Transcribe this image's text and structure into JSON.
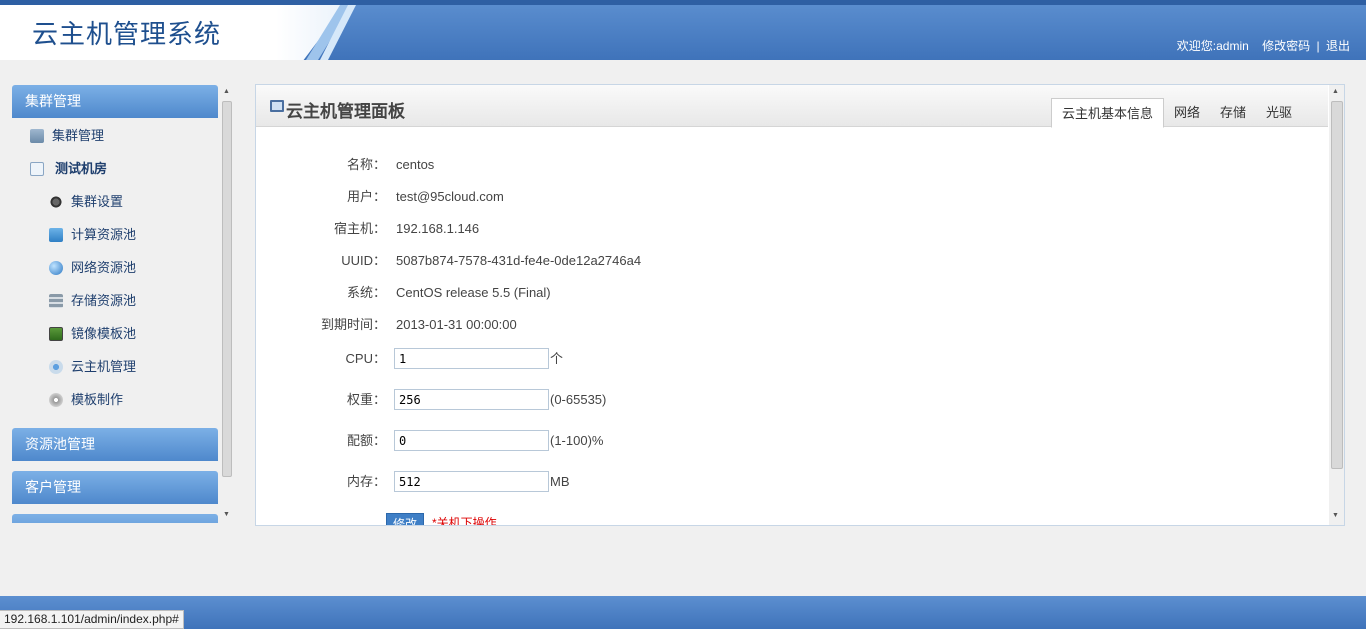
{
  "header": {
    "app_title": "云主机管理系统",
    "welcome": "欢迎您:admin",
    "change_password": "修改密码",
    "separator": "|",
    "logout": "退出"
  },
  "sidebar": {
    "group_cluster": "集群管理",
    "items": [
      {
        "label": "集群管理",
        "icon": "cluster-icon"
      },
      {
        "label": "测试机房",
        "icon": "expand-icon"
      }
    ],
    "sub_items": [
      {
        "label": "集群设置",
        "icon": "gears-icon"
      },
      {
        "label": "计算资源池",
        "icon": "folder-icon"
      },
      {
        "label": "网络资源池",
        "icon": "globe-icon"
      },
      {
        "label": "存储资源池",
        "icon": "storage-icon"
      },
      {
        "label": "镜像模板池",
        "icon": "image-icon"
      },
      {
        "label": "云主机管理",
        "icon": "vm-icon"
      },
      {
        "label": "模板制作",
        "icon": "disc-icon"
      }
    ],
    "group_resource": "资源池管理",
    "group_customer": "客户管理"
  },
  "panel": {
    "title": "云主机管理面板",
    "tabs": [
      "云主机基本信息",
      "网络",
      "存储",
      "光驱"
    ],
    "active_tab": 0,
    "fields": [
      {
        "label": "名称：",
        "value": "centos"
      },
      {
        "label": "用户：",
        "value": "test@95cloud.com"
      },
      {
        "label": "宿主机：",
        "value": "192.168.1.146"
      },
      {
        "label": "UUID：",
        "value": "5087b874-7578-431d-fe4e-0de12a2746a4"
      },
      {
        "label": "系统：",
        "value": "CentOS release 5.5 (Final)"
      },
      {
        "label": "到期时间：",
        "value": "2013-01-31 00:00:00"
      }
    ],
    "inputs": [
      {
        "label": "CPU：",
        "value": "1",
        "unit": "个"
      },
      {
        "label": "权重：",
        "value": "256",
        "unit": "(0-65535)"
      },
      {
        "label": "配额：",
        "value": "0",
        "unit": "(1-100)%"
      },
      {
        "label": "内存：",
        "value": "512",
        "unit": "MB"
      }
    ],
    "modify_button": "修改",
    "warning": "*关机下操作"
  },
  "statusbar": {
    "url": "192.168.1.101/admin/index.php#"
  },
  "colors": {
    "header_blue": "#3f73ba",
    "sidebar_head": "#4e88cc",
    "warning_red": "#dd0000"
  }
}
